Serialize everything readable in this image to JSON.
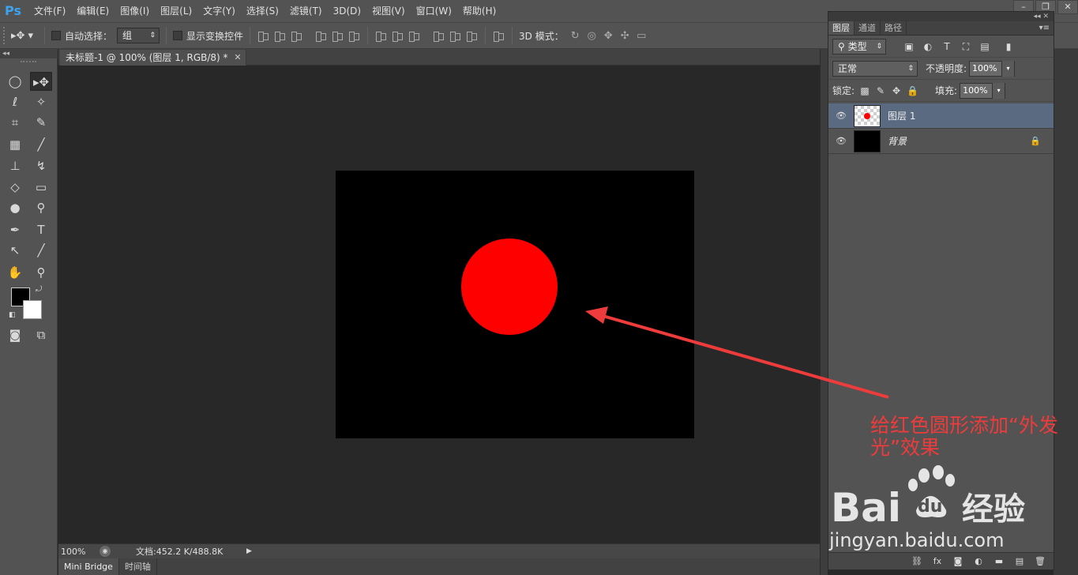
{
  "app": {
    "logo": "Ps"
  },
  "menu": [
    "文件(F)",
    "编辑(E)",
    "图像(I)",
    "图层(L)",
    "文字(Y)",
    "选择(S)",
    "滤镜(T)",
    "3D(D)",
    "视图(V)",
    "窗口(W)",
    "帮助(H)"
  ],
  "options": {
    "auto_select_label": "自动选择：",
    "auto_select_value": "组",
    "show_transform_label": "显示变换控件",
    "mode3d_label": "3D 模式："
  },
  "document": {
    "tab_title": "未标题-1 @ 100% (图层 1, RGB/8) *",
    "zoom": "100%",
    "doc_size": "文档:452.2 K/488.8K",
    "canvas_color": "#000000",
    "circle_color": "#ff0000",
    "annotation_color": "#ee3b3b"
  },
  "annotation": {
    "text": "给红色圆形添加“外发光”效果"
  },
  "bottom_tabs": [
    "Mini Bridge",
    "时间轴"
  ],
  "layers_panel": {
    "tabs": [
      "图层",
      "通道",
      "路径"
    ],
    "filter_kind": "类型",
    "blend_mode": "正常",
    "opacity_label": "不透明度:",
    "opacity_value": "100%",
    "lock_label": "锁定:",
    "fill_label": "填充:",
    "fill_value": "100%",
    "layers": [
      {
        "name": "图层 1",
        "selected": true
      },
      {
        "name": "背景",
        "selected": false,
        "locked": true
      }
    ]
  },
  "watermark": {
    "brand": "Bai",
    "brand_tail": "经验",
    "url": "jingyan.baidu.com"
  }
}
